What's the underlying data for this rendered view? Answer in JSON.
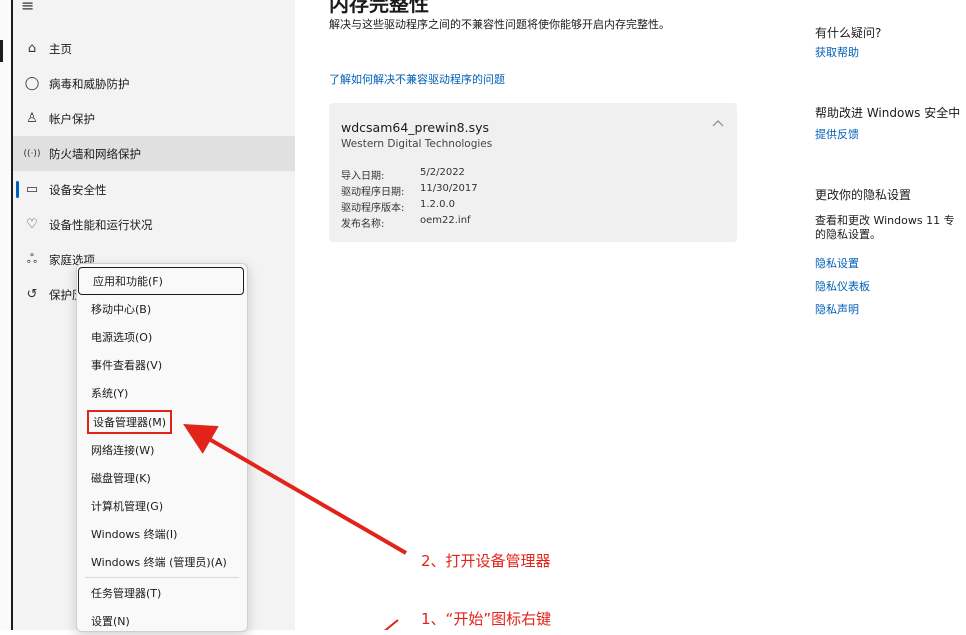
{
  "sidebar": {
    "items": [
      {
        "icon": "home-icon",
        "glyph": "⌂",
        "label": "主页"
      },
      {
        "icon": "shield-icon",
        "glyph": "◯",
        "label": "病毒和威胁防护"
      },
      {
        "icon": "person-icon",
        "glyph": "♙",
        "label": "帐户保护"
      },
      {
        "icon": "wireless-icon",
        "glyph": "((·))",
        "label": "防火墙和网络保护"
      },
      {
        "icon": "laptop-icon",
        "glyph": "▭",
        "label": "设备安全性"
      },
      {
        "icon": "heart-icon",
        "glyph": "♡",
        "label": "设备性能和运行状况"
      },
      {
        "icon": "family-icon",
        "glyph": "ஃ",
        "label": "家庭选项"
      },
      {
        "icon": "history-icon",
        "glyph": "↺",
        "label": "保护历"
      }
    ]
  },
  "context_menu": {
    "items": [
      "应用和功能(F)",
      "移动中心(B)",
      "电源选项(O)",
      "事件查看器(V)",
      "系统(Y)",
      "设备管理器(M)",
      "网络连接(W)",
      "磁盘管理(K)",
      "计算机管理(G)",
      "Windows 终端(I)",
      "Windows 终端 (管理员)(A)",
      "任务管理器(T)",
      "设置(N)"
    ]
  },
  "main": {
    "title": "内存完整性",
    "description": "解决与这些驱动程序之间的不兼容性问题将使你能够开启内存完整性。",
    "learn_link": "了解如何解决不兼容驱动程序的问题",
    "driver": {
      "name": "wdcsam64_prewin8.sys",
      "vendor": "Western Digital Technologies",
      "fields": [
        {
          "key": "导入日期:",
          "value": "5/2/2022"
        },
        {
          "key": "驱动程序日期:",
          "value": "11/30/2017"
        },
        {
          "key": "驱动程序版本:",
          "value": "1.2.0.0"
        },
        {
          "key": "发布名称:",
          "value": "oem22.inf"
        }
      ]
    }
  },
  "right_panel": {
    "question_title": "有什么疑问?",
    "get_help": "获取帮助",
    "improve_title": "帮助改进 Windows 安全中",
    "feedback": "提供反馈",
    "privacy_title": "更改你的隐私设置",
    "privacy_text_1": "查看和更改 Windows 11 专",
    "privacy_text_2": "的隐私设置。",
    "privacy_settings": "隐私设置",
    "privacy_dashboard": "隐私仪表板",
    "privacy_statement": "隐私声明"
  },
  "annotations": {
    "step2": "2、打开设备管理器",
    "step1": "1、“开始”图标右键"
  }
}
